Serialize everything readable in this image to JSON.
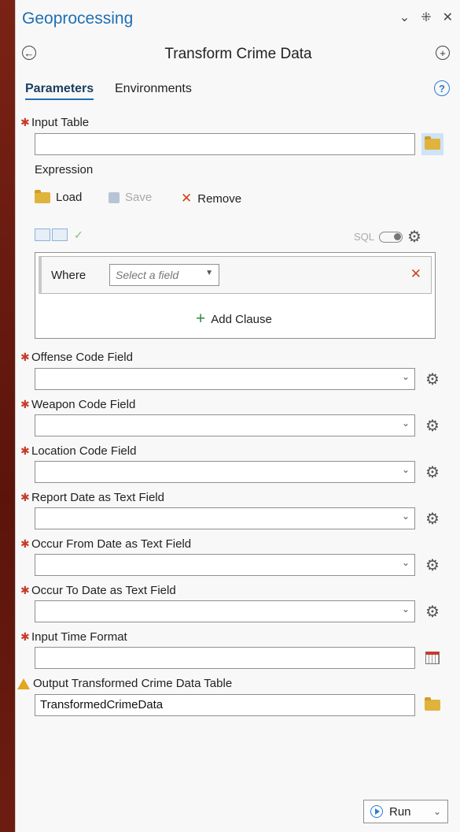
{
  "pane": {
    "title": "Geoprocessing",
    "controls": {
      "menu": "⌄",
      "pin": "⁜",
      "close": "✕"
    }
  },
  "tool": {
    "title": "Transform Crime Data"
  },
  "tabs": [
    {
      "label": "Parameters"
    },
    {
      "label": "Environments"
    }
  ],
  "help": "?",
  "input_table": {
    "label": "Input Table",
    "value": ""
  },
  "expression": {
    "label": "Expression",
    "load": "Load",
    "save": "Save",
    "remove": "Remove",
    "sql_label": "SQL",
    "where_label": "Where",
    "select_placeholder": "Select a field",
    "add_clause": "Add Clause"
  },
  "fields": [
    {
      "label": "Offense Code Field",
      "value": ""
    },
    {
      "label": "Weapon Code Field",
      "value": ""
    },
    {
      "label": "Location Code Field",
      "value": ""
    },
    {
      "label": "Report Date as Text Field",
      "value": ""
    },
    {
      "label": "Occur From Date as Text Field",
      "value": ""
    },
    {
      "label": "Occur To Date as Text Field",
      "value": ""
    }
  ],
  "time_format": {
    "label": "Input Time Format",
    "value": ""
  },
  "output": {
    "label": "Output Transformed Crime Data Table",
    "value": "TransformedCrimeData"
  },
  "run": {
    "label": "Run"
  },
  "colors": {
    "accent": "#1f6fb5",
    "required": "#c83b2a",
    "remove": "#d0451b",
    "add": "#2e8b3a"
  }
}
